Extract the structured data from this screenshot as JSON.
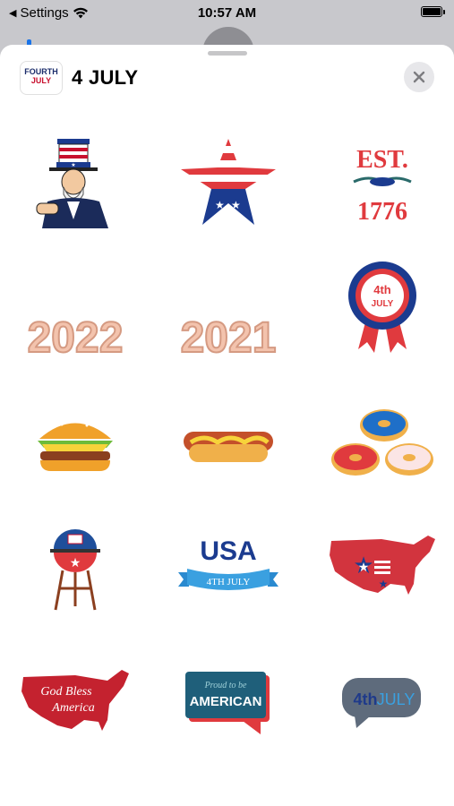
{
  "status_bar": {
    "back_label": "Settings",
    "time": "10:57 AM",
    "back_icon": "back-arrow-icon",
    "wifi_icon": "wifi-icon",
    "battery_icon": "battery-icon"
  },
  "header": {
    "app_icon_line1": "FOURTH",
    "app_icon_line2": "JULY",
    "title": "4 JULY",
    "close_icon": "close-icon"
  },
  "stickers": [
    {
      "name": "uncle-sam"
    },
    {
      "name": "flag-star"
    },
    {
      "name": "est-1776",
      "text1": "EST.",
      "text2": "1776"
    },
    {
      "name": "balloon-2022",
      "text": "2022"
    },
    {
      "name": "balloon-2021",
      "text": "2021"
    },
    {
      "name": "4th-july-ribbon",
      "text1": "4th",
      "text2": "JULY"
    },
    {
      "name": "hamburger"
    },
    {
      "name": "hot-dog"
    },
    {
      "name": "donuts"
    },
    {
      "name": "bbq-grill"
    },
    {
      "name": "usa-banner",
      "text1": "USA",
      "text2": "4TH JULY"
    },
    {
      "name": "usa-map-flag"
    },
    {
      "name": "god-bless-america-map",
      "text1": "God Bless",
      "text2": "America"
    },
    {
      "name": "proud-american-bubble",
      "text1": "Proud to be",
      "text2": "AMERICAN"
    },
    {
      "name": "4th-july-bubble",
      "text1": "4th",
      "text2": "JULY"
    }
  ],
  "colors": {
    "red": "#c8102e",
    "blue": "#1b3b8f",
    "sheet": "#ffffff",
    "dim": "#c8c8cc"
  }
}
